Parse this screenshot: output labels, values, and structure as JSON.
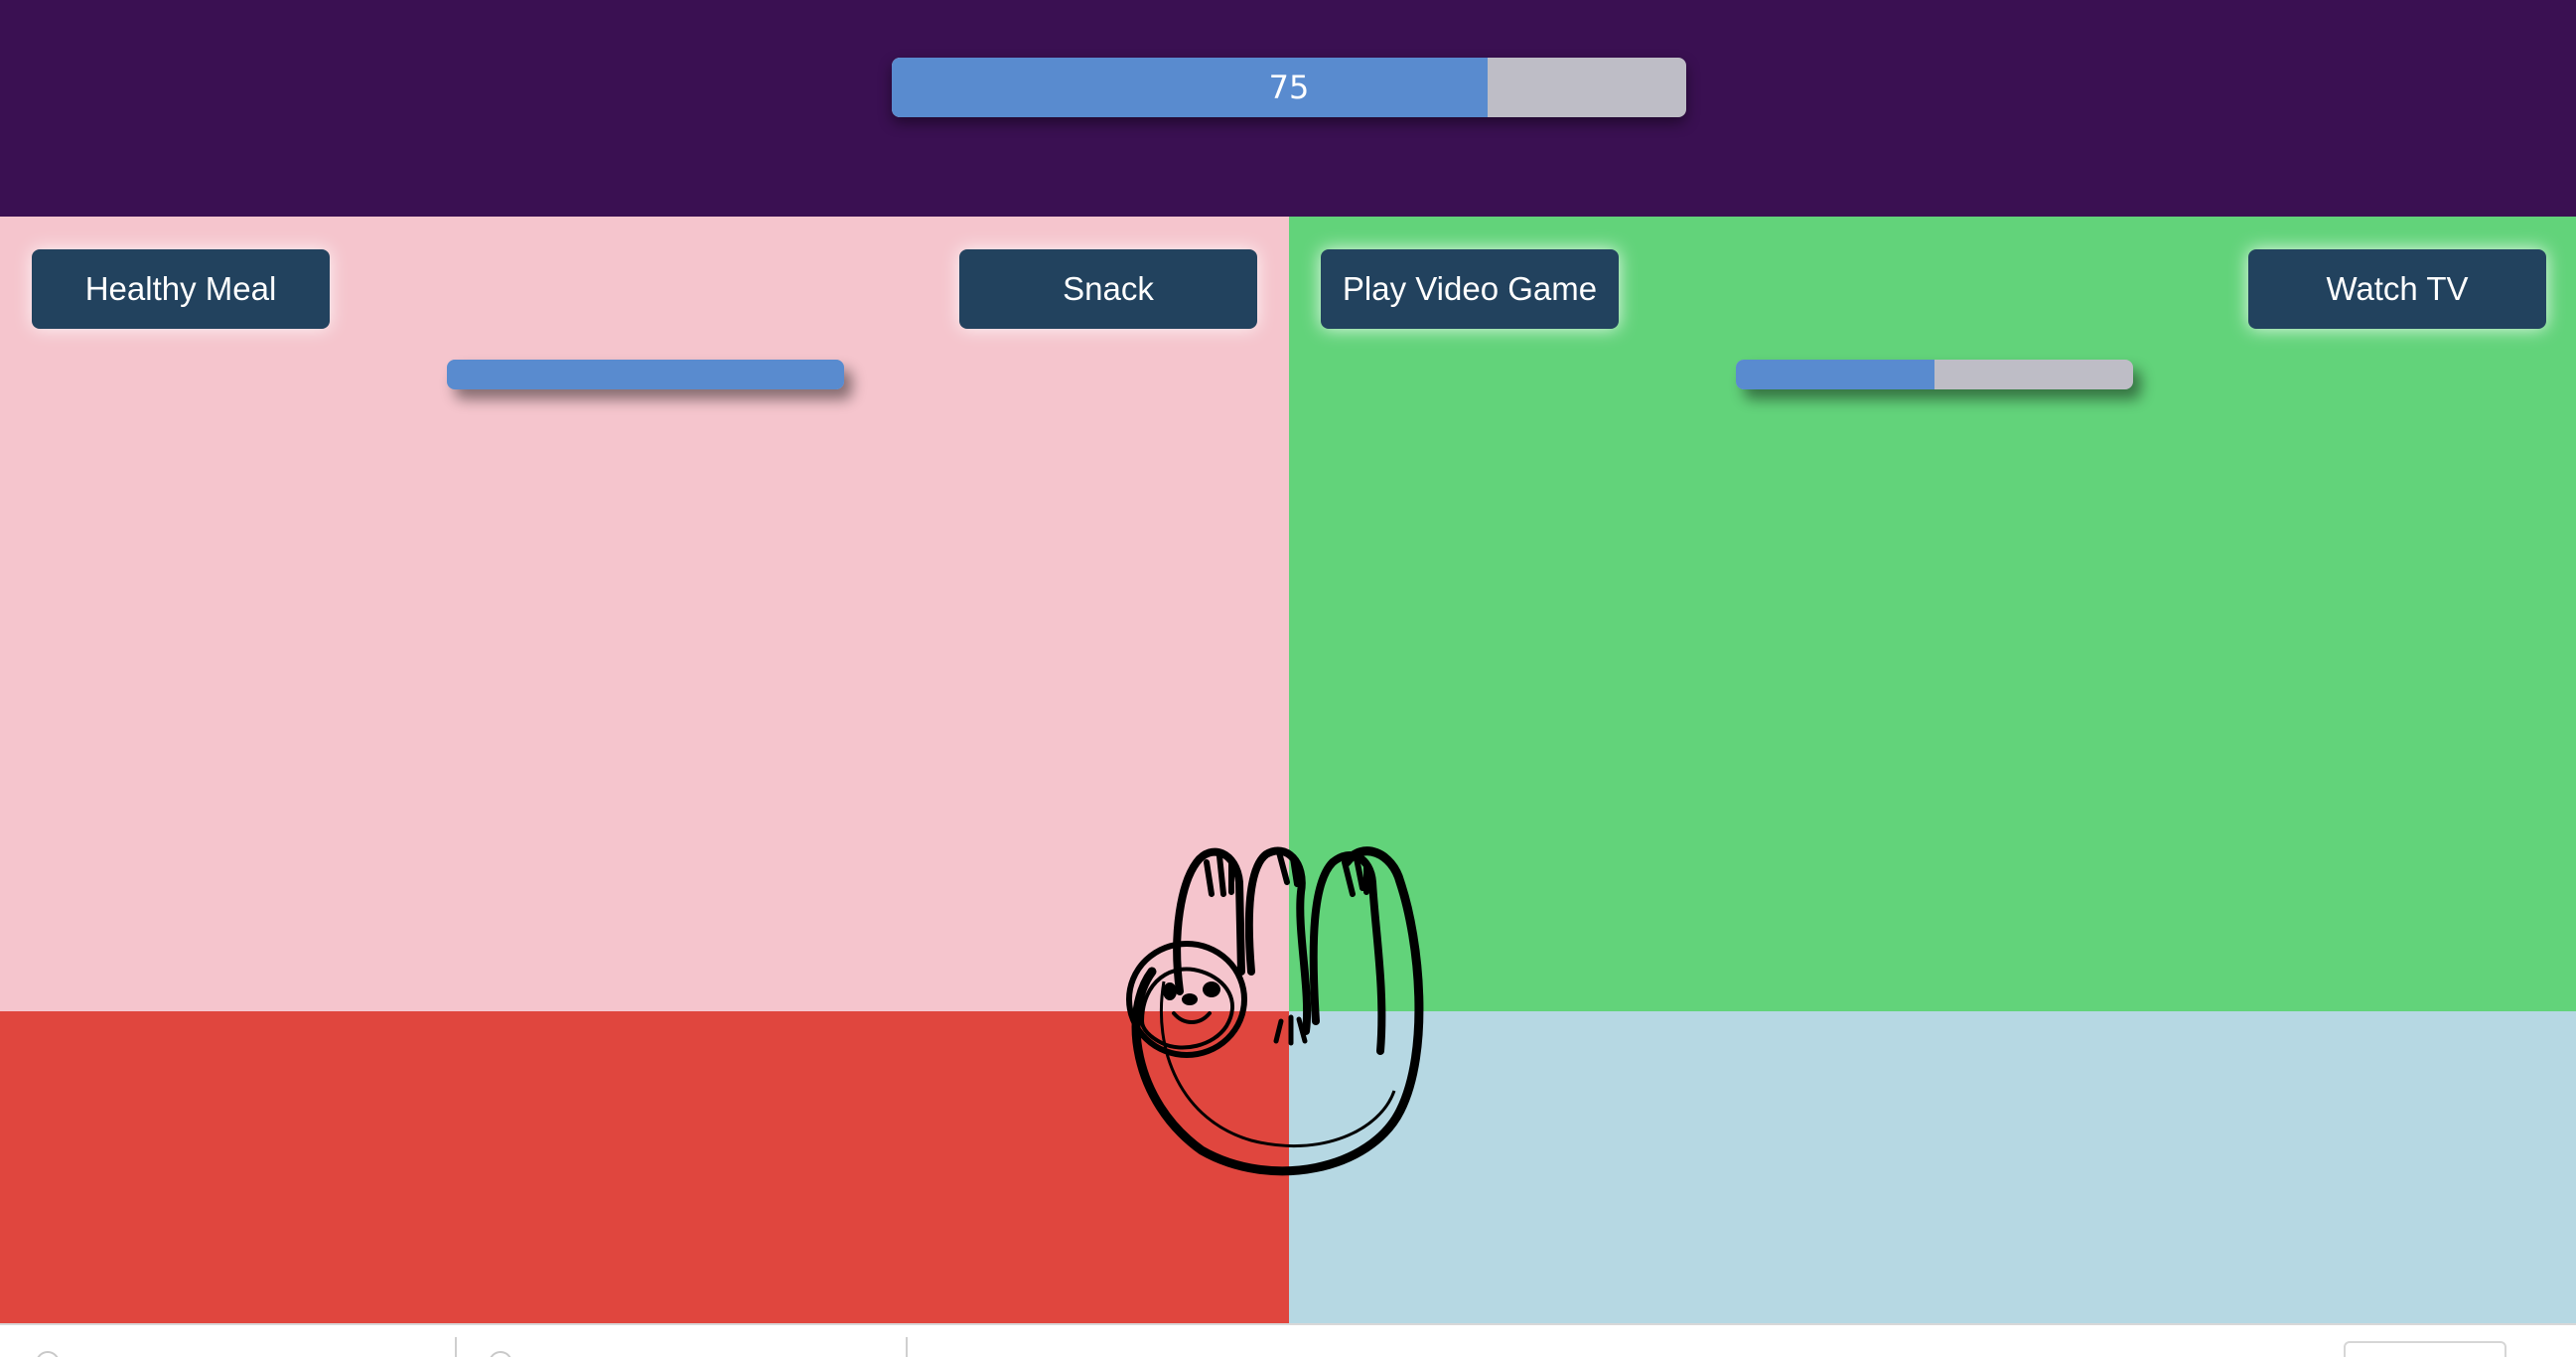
{
  "header": {
    "main_progress": {
      "value_label": "75",
      "value": 75,
      "max": 100,
      "fill_color": "#598bcf",
      "track_color": "#bebdc6"
    },
    "background_color": "#3a1052"
  },
  "food_panel": {
    "background_color": "#f5c5cd",
    "buttons": [
      {
        "label": "Healthy Meal"
      },
      {
        "label": "Snack"
      }
    ],
    "progress": {
      "value": 100,
      "max": 100
    }
  },
  "fun_panel": {
    "background_color": "#62d37a",
    "buttons": [
      {
        "label": "Play Video Game"
      },
      {
        "label": "Watch TV"
      }
    ],
    "progress": {
      "value": 50,
      "max": 100
    }
  },
  "lower_panels": {
    "left_color": "#e0463e",
    "right_color": "#b6d8e3"
  },
  "button_color": "#22425e",
  "mascot": {
    "icon": "sloth-icon"
  }
}
